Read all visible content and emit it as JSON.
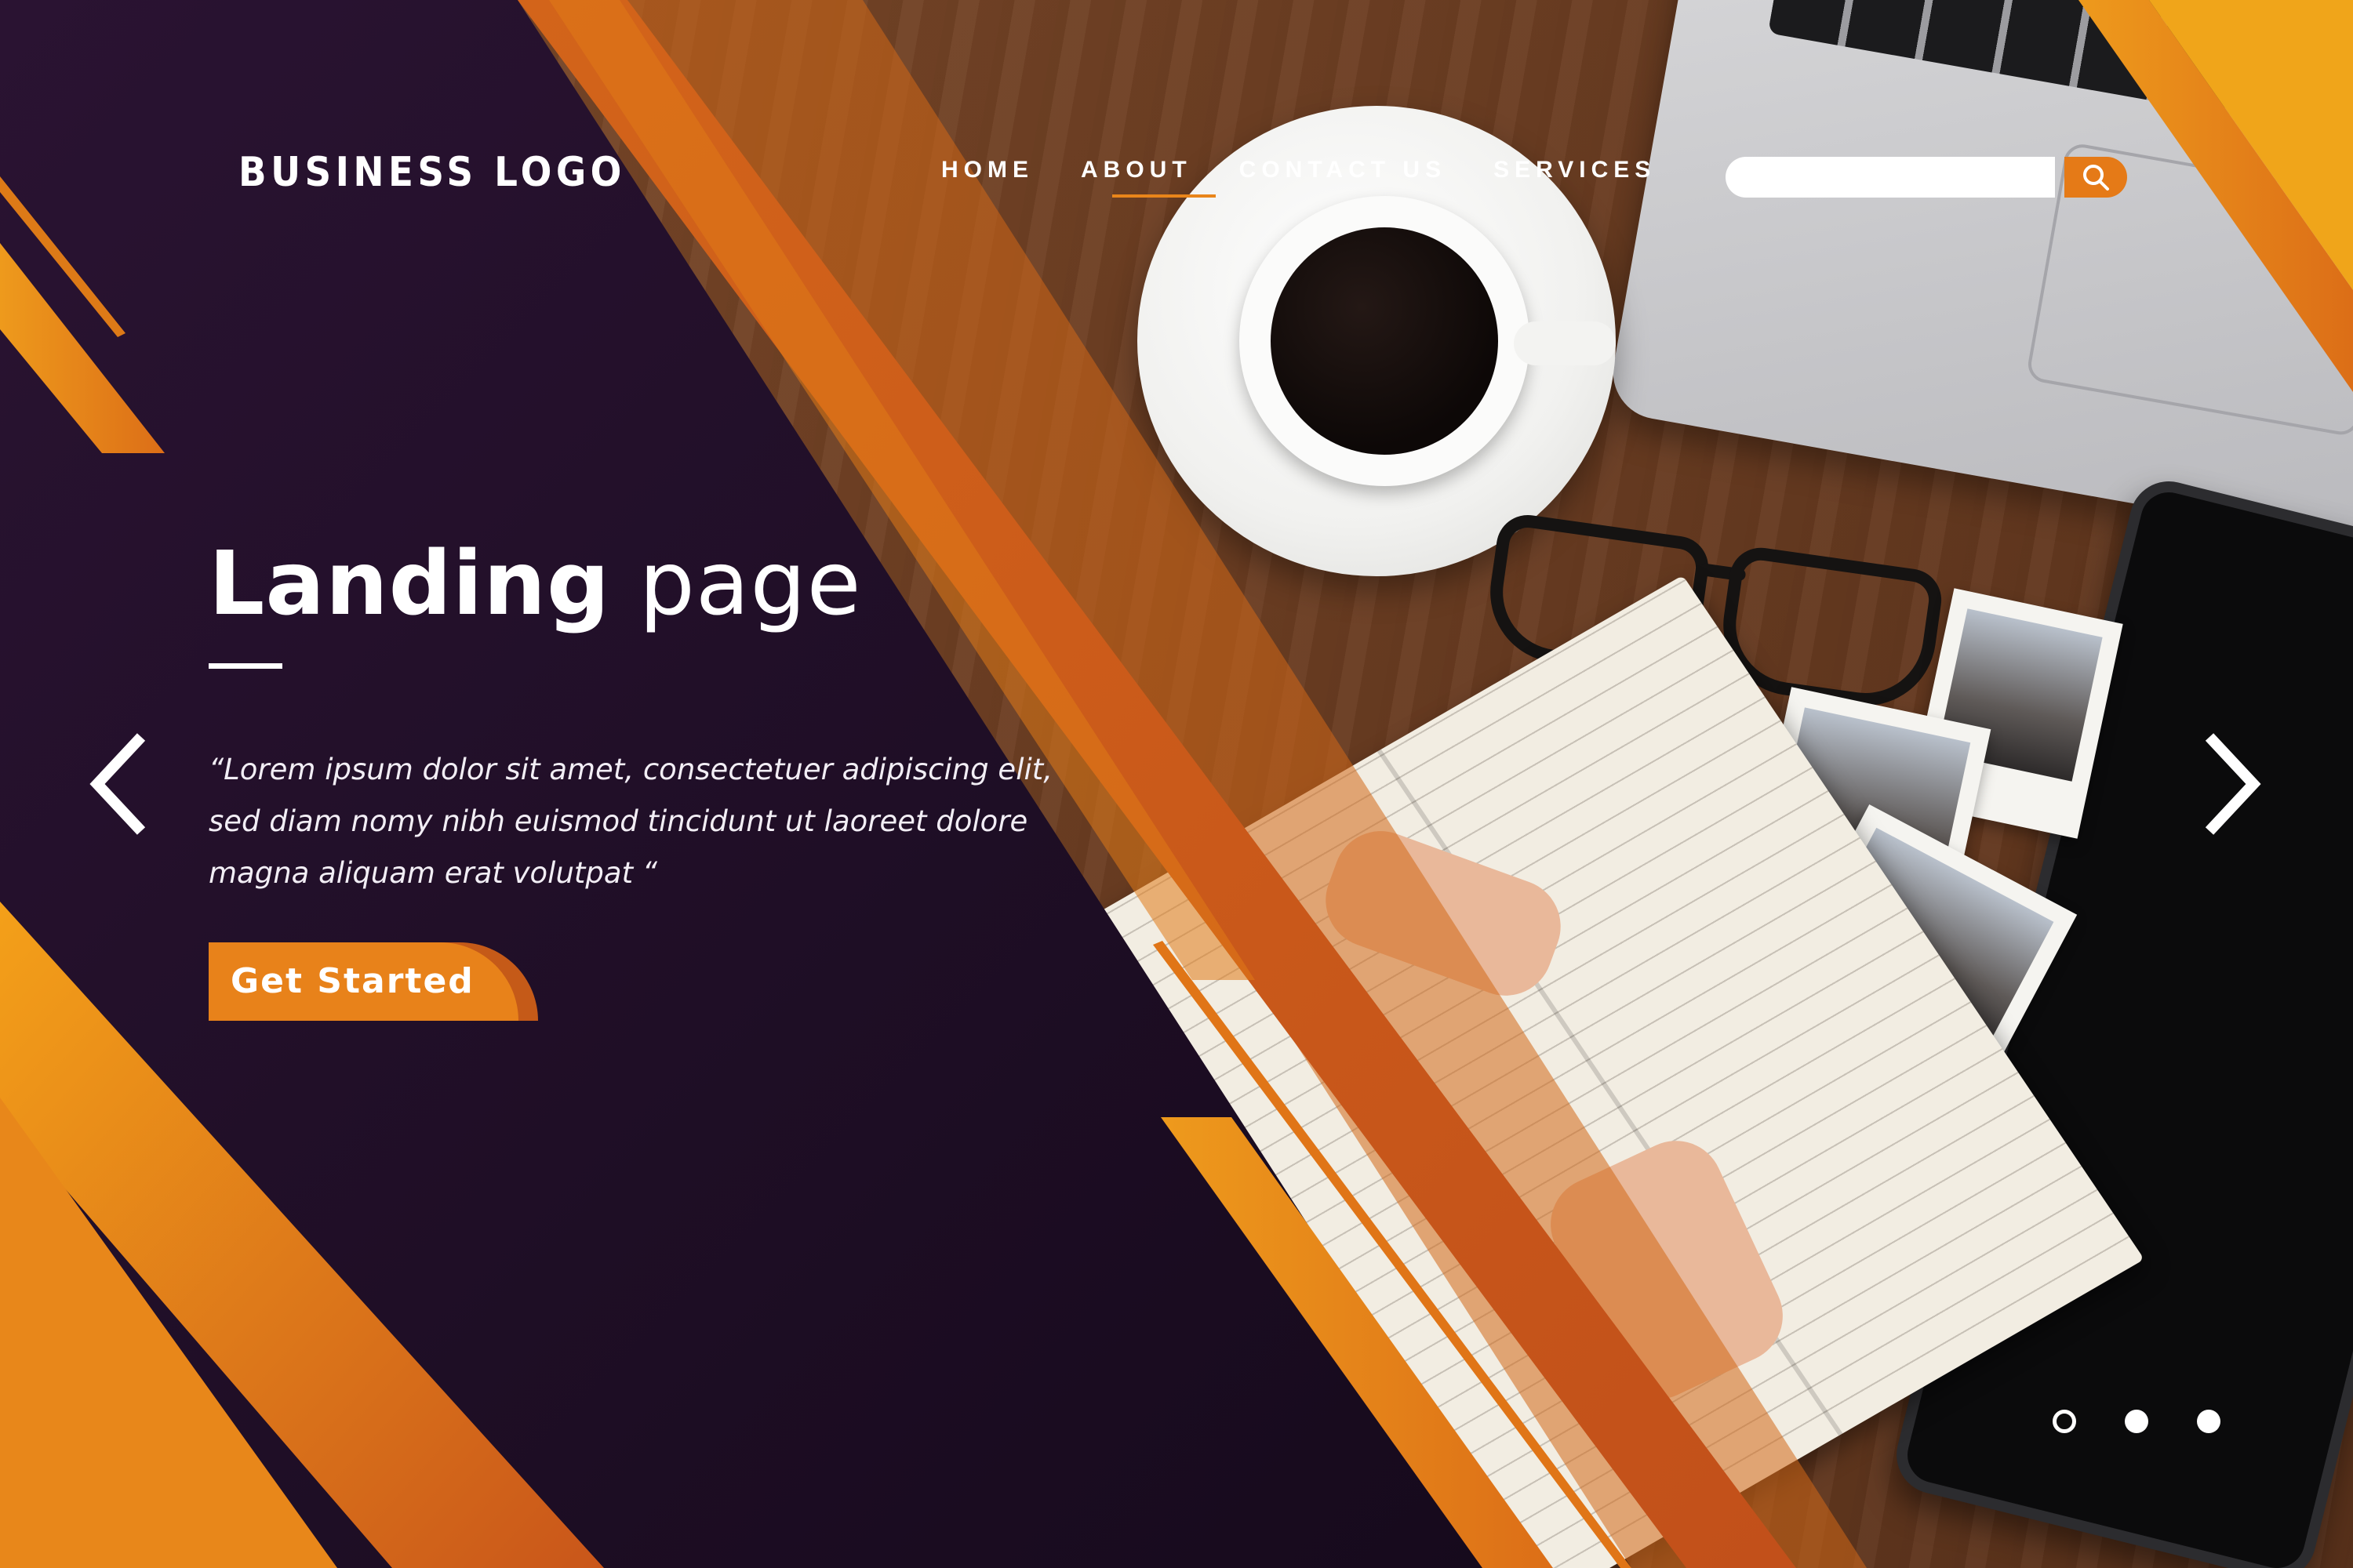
{
  "header": {
    "logo": "BUSINESS LOGO",
    "nav": [
      {
        "label": "HOME",
        "active": false
      },
      {
        "label": "ABOUT",
        "active": true
      },
      {
        "label": "CONTACT US",
        "active": false
      },
      {
        "label": "SERVICES",
        "active": false
      }
    ],
    "search": {
      "placeholder": "",
      "value": "",
      "icon": "search-icon"
    }
  },
  "hero": {
    "title_bold": "Landing",
    "title_light": "page",
    "quote": "“Lorem ipsum dolor sit amet, consectetuer adipiscing elit, sed diam nomy nibh euismod tincidunt ut laoreet dolore magna aliquam erat volutpat “",
    "cta_label": "Get Started"
  },
  "carousel": {
    "prev_icon": "chevron-left-icon",
    "next_icon": "chevron-right-icon",
    "slides": 3,
    "active_slide": 1
  },
  "colors": {
    "panel": "#1e0e26",
    "accent": "#e8821a",
    "accent_dark": "#c55a18",
    "accent_light": "#f0a51a",
    "text": "#ffffff"
  }
}
